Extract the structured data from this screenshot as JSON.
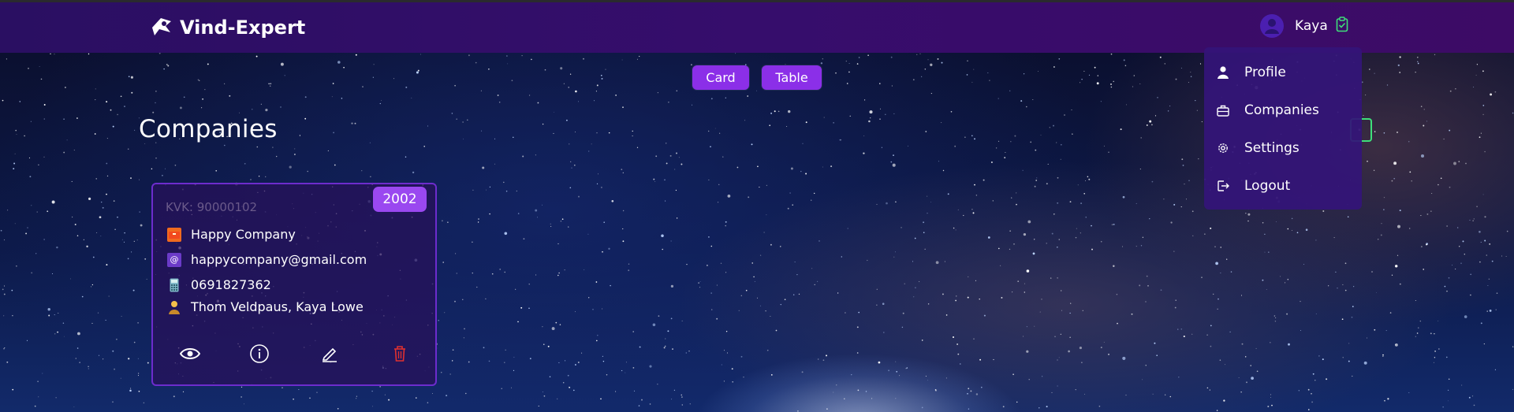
{
  "brand": {
    "name": "Vind-Expert"
  },
  "user": {
    "name": "Kaya"
  },
  "view_toggle": {
    "card_label": "Card",
    "table_label": "Table"
  },
  "page": {
    "title": "Companies"
  },
  "company_card": {
    "kvk": "KVK: 90000102",
    "year": "2002",
    "name": "Happy Company",
    "email": "happycompany@gmail.com",
    "phone": "0691827362",
    "contacts": "Thom Veldpaus, Kaya Lowe",
    "actions": [
      "eye-icon",
      "info-icon",
      "edit-icon",
      "trash-icon"
    ]
  },
  "user_menu": {
    "items": [
      {
        "label": "Profile",
        "icon": "person-icon"
      },
      {
        "label": "Companies",
        "icon": "briefcase-icon"
      },
      {
        "label": "Settings",
        "icon": "gear-icon"
      },
      {
        "label": "Logout",
        "icon": "logout-icon"
      }
    ]
  },
  "colors": {
    "navbar": "#360d6c",
    "accent": "#8b2fe8",
    "card_border": "#6d2ccd",
    "delete": "#e03030",
    "add_icon": "#3ee07a"
  }
}
